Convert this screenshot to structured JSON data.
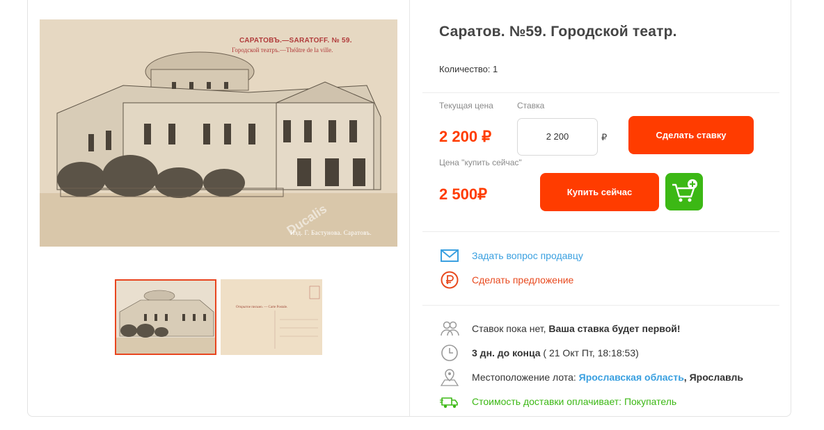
{
  "gallery": {
    "photo_title": "САРАТОВЪ.—SARATOFF. № 59.",
    "photo_subtitle": "Городской театръ.—Théâtre de la ville.",
    "photo_publisher": "Изд. Г. Бастунова. Саратовъ.",
    "watermark": "Ducalis",
    "thumb2_lines": [
      "Открытое письмо. — Carte Postale."
    ]
  },
  "lot": {
    "title": "Саратов. №59. Городской театр.",
    "quantity": "Количество: 1"
  },
  "pricing": {
    "current_price_label": "Текущая цена",
    "current_price": "2 200 ₽",
    "bid_label": "Ставка",
    "bid_value": "2 200",
    "bid_currency": "₽",
    "bid_button": "Сделать ставку",
    "buy_now_label": "Цена \"купить сейчас\"",
    "buy_now_price": "2 500₽",
    "buy_now_button": "Купить сейчас"
  },
  "actions": {
    "ask_seller": "Задать вопрос продавцу",
    "make_offer": "Сделать предложение"
  },
  "info": {
    "bids_prefix": "Ставок пока нет, ",
    "bids_bold": "Ваша ставка будет первой!",
    "time_bold": "3 дн. до конца",
    "time_rest": " ( 21 Окт Пт, 18:18:53)",
    "location_prefix": "Местоположение лота: ",
    "location_region": "Ярославская область",
    "location_city": ", Ярославль",
    "delivery": "Стоимость доставки оплачивает: Покупатель"
  },
  "colors": {
    "accent": "#ff3c00",
    "link": "#3aa0e0",
    "green": "#3cb815"
  },
  "icons": [
    "envelope-icon",
    "ruble-circle-icon",
    "users-icon",
    "clock-icon",
    "location-pin-icon",
    "delivery-truck-icon",
    "add-to-cart-icon"
  ]
}
